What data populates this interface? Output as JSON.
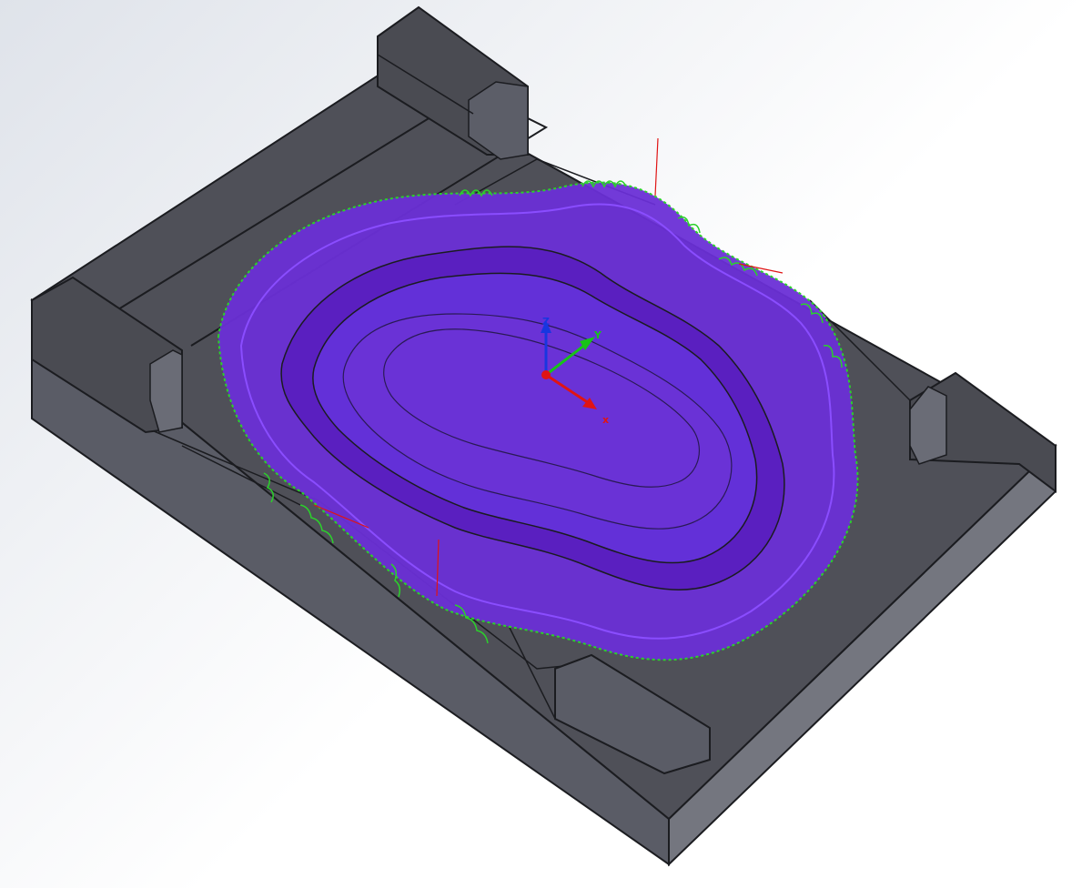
{
  "colors": {
    "background_top": "#dfe3ea",
    "background_bottom": "#ffffff",
    "part_top_face": "#4f5058",
    "part_side_face": "#5a5c66",
    "part_front_face": "#74767f",
    "part_edge": "#1b1c20",
    "toolpath_fill": "#6a2fd6",
    "toolpath_line": "#8a4dff",
    "entry_moves": "#2bd12b",
    "link_moves": "#e01414",
    "axis_x": "#e01414",
    "axis_y": "#18c418",
    "axis_z": "#1836e0"
  },
  "icons": {
    "triad": "coordinate-triad-icon",
    "origin": "origin-point-icon"
  },
  "triad": {
    "x_label": "x",
    "y_label": "Y",
    "z_label": "Z"
  }
}
